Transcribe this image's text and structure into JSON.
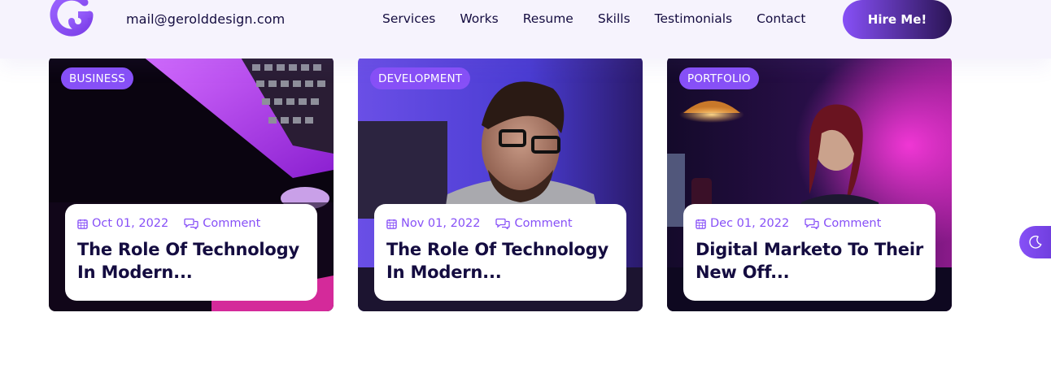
{
  "header": {
    "email": "mail@gerolddesign.com",
    "nav": [
      "Services",
      "Works",
      "Resume",
      "Skills",
      "Testimonials",
      "Contact"
    ],
    "cta": "Hire Me!"
  },
  "colors": {
    "accent": "#8750f7",
    "dark": "#140c40",
    "header_bg": "#f6f3fd"
  },
  "cards": [
    {
      "category": "BUSINESS",
      "date": "Oct 01, 2022",
      "comment": "Comment",
      "title_line1": "The Role Of Technology",
      "title_line2": "In Modern..."
    },
    {
      "category": "DEVELOPMENT",
      "date": "Nov 01, 2022",
      "comment": "Comment",
      "title_line1": "The Role Of Technology",
      "title_line2": "In Modern..."
    },
    {
      "category": "PORTFOLIO",
      "date": "Dec 01, 2022",
      "comment": "Comment",
      "title_line1": "Digital Marketo To Their",
      "title_line2": "New Off..."
    }
  ],
  "icons": {
    "logo": "g-logo",
    "calendar": "calendar-icon",
    "comment": "comment-icon",
    "theme": "moon-icon"
  }
}
